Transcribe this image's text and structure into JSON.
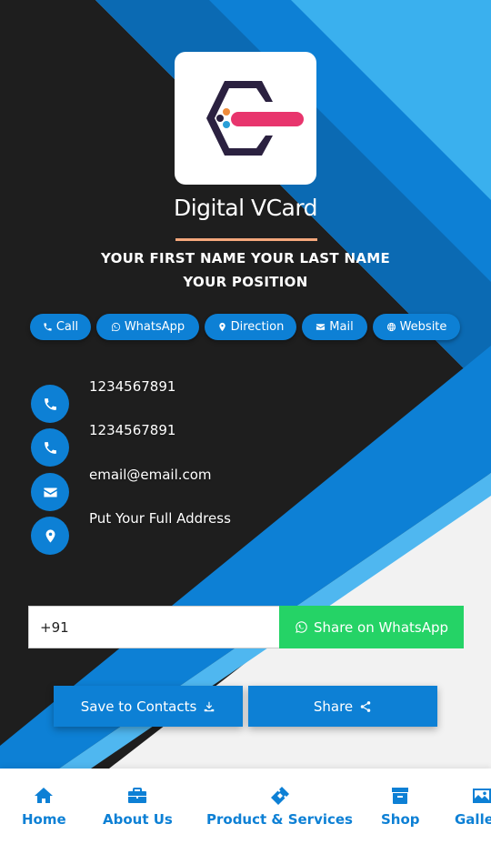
{
  "brand": {
    "title": "Digital VCard",
    "logo_icon": "hexagon-brand-logo"
  },
  "profile": {
    "name": "YOUR FIRST NAME YOUR LAST NAME",
    "position": "YOUR POSITION"
  },
  "quick_links": [
    {
      "label": "Call",
      "icon": "phone-icon"
    },
    {
      "label": "WhatsApp",
      "icon": "whatsapp-icon"
    },
    {
      "label": "Direction",
      "icon": "map-marker-icon"
    },
    {
      "label": "Mail",
      "icon": "envelope-icon"
    },
    {
      "label": "Website",
      "icon": "globe-icon"
    }
  ],
  "contacts": [
    {
      "text": "1234567891",
      "icon": "phone-icon"
    },
    {
      "text": "1234567891",
      "icon": "phone-icon"
    },
    {
      "text": "email@email.com",
      "icon": "envelope-icon"
    },
    {
      "text": "Put Your Full Address",
      "icon": "map-marker-icon"
    }
  ],
  "share_whatsapp": {
    "input_value": "+91",
    "button_label": "Share on WhatsApp"
  },
  "actions": {
    "save_label": "Save to Contacts",
    "share_label": "Share"
  },
  "nav": [
    {
      "label": "Home",
      "icon": "home-icon"
    },
    {
      "label": "About Us",
      "icon": "briefcase-icon"
    },
    {
      "label": "Product & Services",
      "icon": "ticket-icon"
    },
    {
      "label": "Shop",
      "icon": "archive-icon"
    },
    {
      "label": "Gallery",
      "icon": "image-icon"
    }
  ],
  "colors": {
    "accent": "#0d80d5",
    "dark": "#1e1e1e",
    "whatsapp": "#25d366",
    "underline": "#f4a77c"
  }
}
